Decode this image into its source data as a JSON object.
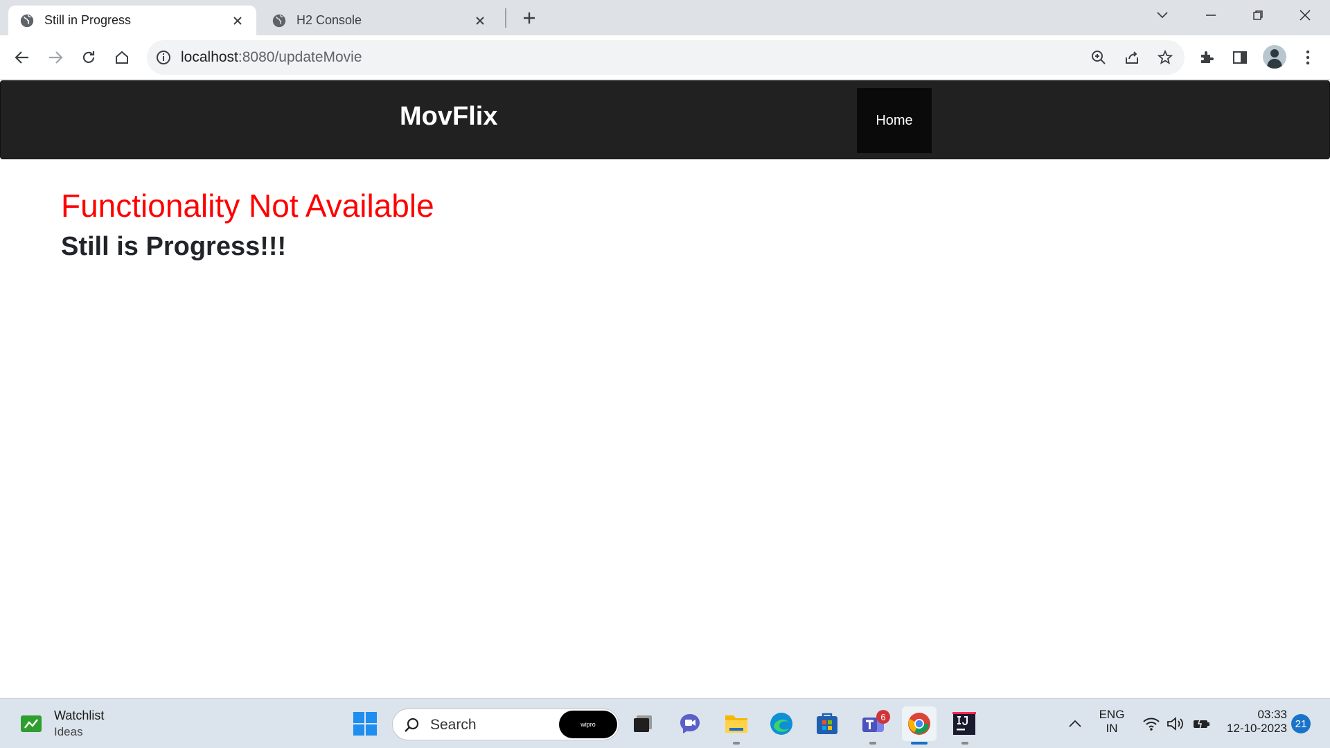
{
  "browser": {
    "tabs": [
      {
        "title": "Still in Progress",
        "active": true
      },
      {
        "title": "H2 Console",
        "active": false
      }
    ],
    "address": {
      "host": "localhost",
      "path": ":8080/updateMovie"
    }
  },
  "page": {
    "brand": "MovFlix",
    "nav": {
      "home": "Home"
    },
    "heading": "Functionality Not Available",
    "subheading": "Still is Progress!!!",
    "colors": {
      "heading": "#ff0000",
      "navbar": "#212121"
    }
  },
  "taskbar": {
    "widget": {
      "title": "Watchlist",
      "subtitle": "Ideas"
    },
    "search": {
      "placeholder": "Search",
      "badge": "wipro"
    },
    "teams_badge": "6",
    "lang": {
      "line1": "ENG",
      "line2": "IN"
    },
    "clock": {
      "time": "03:33",
      "date": "12-10-2023"
    },
    "notifications": "21"
  }
}
